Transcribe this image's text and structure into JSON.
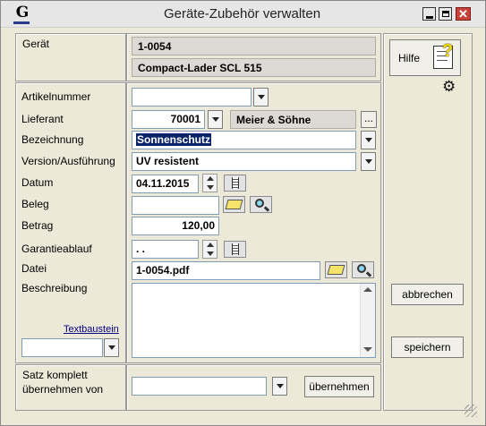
{
  "window": {
    "title": "Geräte-Zubehör verwalten",
    "app_icon_letter": "G"
  },
  "geraet": {
    "label": "Gerät",
    "number": "1-0054",
    "name": "Compact-Lader SCL 515"
  },
  "help": {
    "label": "Hilfe"
  },
  "fields": {
    "artikelnummer": {
      "label": "Artikelnummer",
      "value": ""
    },
    "lieferant": {
      "label": "Lieferant",
      "value": "70001",
      "name": "Meier & Söhne",
      "browse": "..."
    },
    "bezeichnung": {
      "label": "Bezeichnung",
      "value": "Sonnenschutz"
    },
    "version": {
      "label": "Version/Ausführung",
      "value": "UV resistent"
    },
    "datum": {
      "label": "Datum",
      "value": "04.11.2015"
    },
    "beleg": {
      "label": "Beleg",
      "value": ""
    },
    "betrag": {
      "label": "Betrag",
      "value": "120,00"
    },
    "garantie": {
      "label": "Garantieablauf",
      "value": " . ."
    },
    "datei": {
      "label": "Datei",
      "value": "1-0054.pdf"
    },
    "beschreibung": {
      "label": "Beschreibung",
      "value": ""
    }
  },
  "textbaustein": {
    "label": "Textbaustein",
    "value": ""
  },
  "actions": {
    "cancel": "abbrechen",
    "save": "speichern"
  },
  "satz": {
    "label_line1": "Satz komplett",
    "label_line2": "übernehmen von",
    "value": "",
    "button": "übernehmen"
  },
  "colors": {
    "selection": "#0a246a",
    "link": "#000080",
    "help_icon_yellow": "#f5e000"
  }
}
